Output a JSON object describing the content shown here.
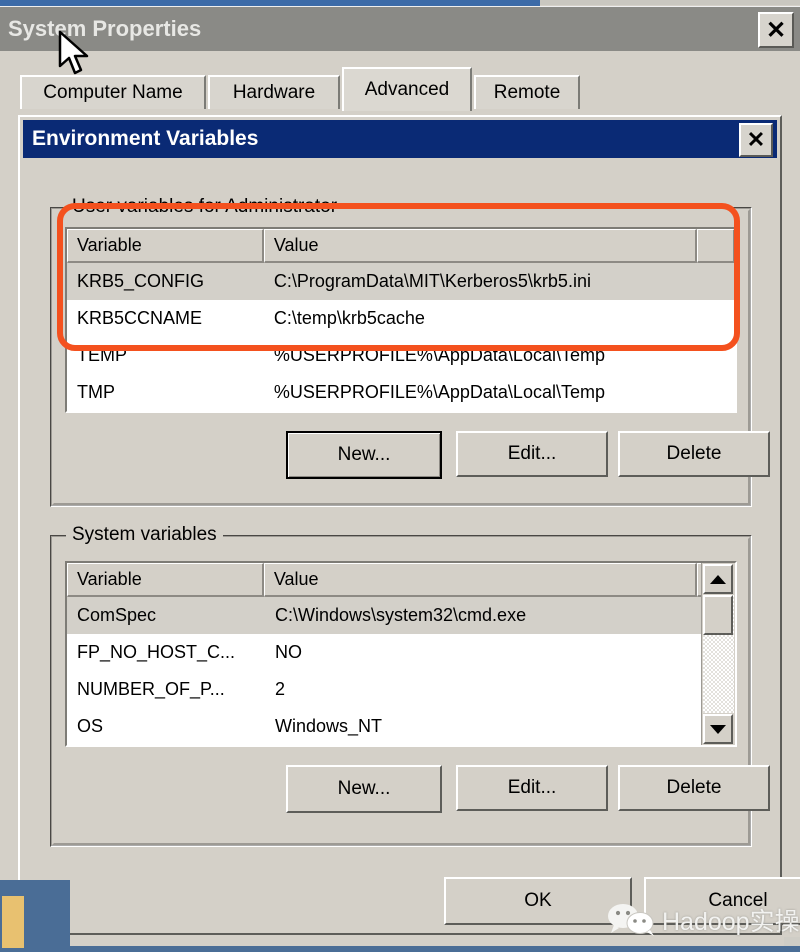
{
  "window": {
    "title": "System Properties",
    "close_label": "✕"
  },
  "tabs": [
    {
      "label": "Computer Name",
      "selected": false
    },
    {
      "label": "Hardware",
      "selected": false
    },
    {
      "label": "Advanced",
      "selected": true
    },
    {
      "label": "Remote",
      "selected": false
    }
  ],
  "dialog": {
    "title": "Environment Variables",
    "close_label": "✕"
  },
  "user_variables": {
    "group_label": "User variables for Administrator",
    "columns": [
      "Variable",
      "Value"
    ],
    "rows": [
      {
        "variable": "KRB5_CONFIG",
        "value": "C:\\ProgramData\\MIT\\Kerberos5\\krb5.ini",
        "selected": true
      },
      {
        "variable": "KRB5CCNAME",
        "value": "C:\\temp\\krb5cache",
        "selected": false
      },
      {
        "variable": "TEMP",
        "value": "%USERPROFILE%\\AppData\\Local\\Temp",
        "selected": false
      },
      {
        "variable": "TMP",
        "value": "%USERPROFILE%\\AppData\\Local\\Temp",
        "selected": false
      }
    ],
    "buttons": {
      "new": "New...",
      "edit": "Edit...",
      "delete": "Delete"
    }
  },
  "system_variables": {
    "group_label": "System variables",
    "columns": [
      "Variable",
      "Value"
    ],
    "rows": [
      {
        "variable": "ComSpec",
        "value": "C:\\Windows\\system32\\cmd.exe",
        "selected": true
      },
      {
        "variable": "FP_NO_HOST_C...",
        "value": "NO",
        "selected": false
      },
      {
        "variable": "NUMBER_OF_P...",
        "value": "2",
        "selected": false
      },
      {
        "variable": "OS",
        "value": "Windows_NT",
        "selected": false
      }
    ],
    "buttons": {
      "new": "New...",
      "edit": "Edit...",
      "delete": "Delete"
    }
  },
  "dialog_buttons": {
    "ok": "OK",
    "cancel": "Cancel"
  },
  "watermark": {
    "text": "Hadoop实操"
  },
  "colors": {
    "face": "#d4d0c8",
    "active_title": "#0a2a75",
    "inactive_title": "#8a8a86",
    "annotation": "#f4511e",
    "selection": "#d3d0c9",
    "taskbar": "#4a6d96"
  }
}
